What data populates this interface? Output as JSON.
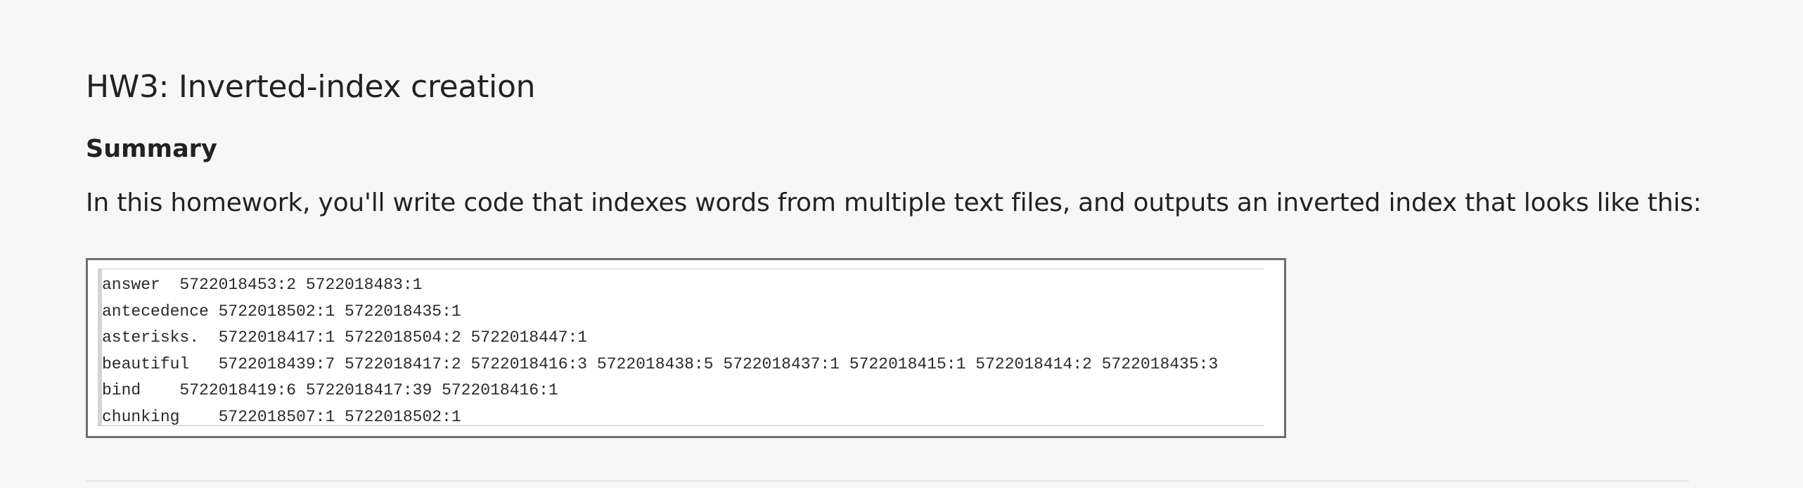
{
  "page": {
    "title": "HW3: Inverted-index creation",
    "summary_heading": "Summary",
    "intro": "In this homework, you'll write code that indexes words from multiple text files, and outputs an inverted index that looks like this:"
  },
  "index_sample": {
    "lines": [
      "answer  5722018453:2 5722018483:1",
      "antecedence 5722018502:1 5722018435:1",
      "asterisks.  5722018417:1 5722018504:2 5722018447:1",
      "beautiful   5722018439:7 5722018417:2 5722018416:3 5722018438:5 5722018437:1 5722018415:1 5722018414:2 5722018435:3",
      "bind    5722018419:6 5722018417:39 5722018416:1",
      "chunking    5722018507:1 5722018502:1"
    ]
  }
}
